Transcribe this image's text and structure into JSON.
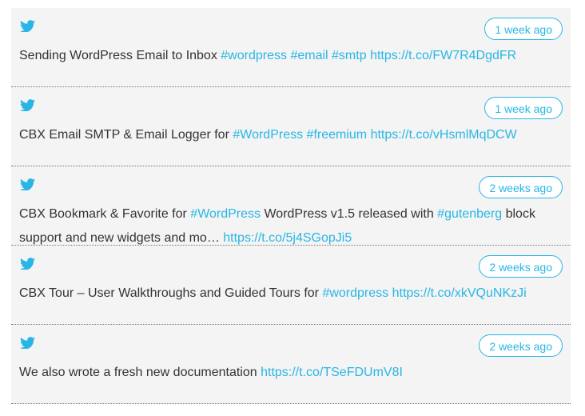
{
  "colors": {
    "accent": "#29b6e5",
    "text": "#333333",
    "card": "#f4f4f4"
  },
  "icon": "twitter-bird-icon",
  "tweets": [
    {
      "time": "1 week ago",
      "parts": [
        {
          "t": "Sending WordPress Email to Inbox "
        },
        {
          "t": "#wordpress",
          "link": true
        },
        {
          "t": " "
        },
        {
          "t": "#email",
          "link": true
        },
        {
          "t": " "
        },
        {
          "t": "#smtp",
          "link": true
        },
        {
          "t": " "
        },
        {
          "t": "https://t.co/FW7R4DgdFR",
          "link": true
        }
      ]
    },
    {
      "time": "1 week ago",
      "parts": [
        {
          "t": "CBX Email SMTP & Email Logger for "
        },
        {
          "t": "#WordPress",
          "link": true
        },
        {
          "t": " "
        },
        {
          "t": "#freemium",
          "link": true
        },
        {
          "t": " "
        },
        {
          "t": "https://t.co/vHsmlMqDCW",
          "link": true
        }
      ]
    },
    {
      "time": "2 weeks ago",
      "parts": [
        {
          "t": "CBX Bookmark & Favorite for "
        },
        {
          "t": "#WordPress",
          "link": true
        },
        {
          "t": " WordPress v1.5 released with "
        },
        {
          "t": "#gutenberg",
          "link": true
        },
        {
          "t": " block support and new widgets and mo… "
        },
        {
          "t": "https://t.co/5j4SGopJi5",
          "link": true
        }
      ]
    },
    {
      "time": "2 weeks ago",
      "parts": [
        {
          "t": "CBX Tour – User Walkthroughs and Guided Tours for "
        },
        {
          "t": "#wordpress",
          "link": true
        },
        {
          "t": " "
        },
        {
          "t": "https://t.co/xkVQuNKzJi",
          "link": true
        }
      ]
    },
    {
      "time": "2 weeks ago",
      "parts": [
        {
          "t": "We also wrote a fresh new documentation "
        },
        {
          "t": "https://t.co/TSeFDUmV8I",
          "link": true
        }
      ]
    }
  ]
}
